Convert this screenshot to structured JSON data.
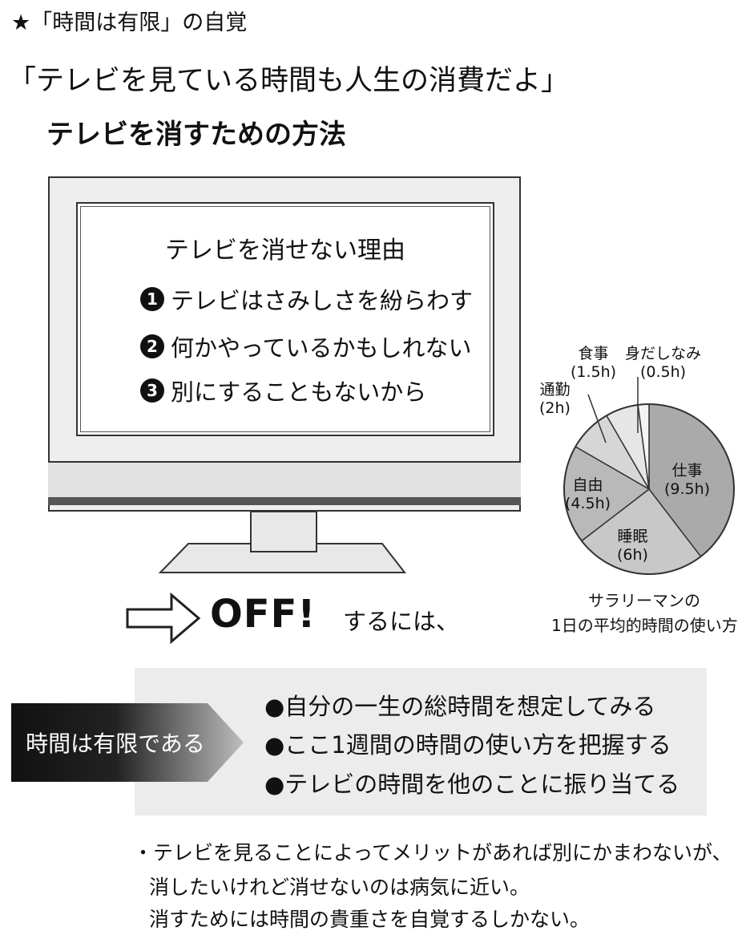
{
  "header": {
    "line1": "★「時間は有限」の自覚",
    "line2": "「テレビを見ている時間も人生の消費だよ」",
    "line3": "テレビを消すための方法"
  },
  "tv": {
    "title": "テレビを消せない理由",
    "reasons": [
      {
        "num": "1",
        "text": "テレビはさみしさを紛らわす"
      },
      {
        "num": "2",
        "text": "何かやっているかもしれない"
      },
      {
        "num": "3",
        "text": "別にすることもないから"
      }
    ]
  },
  "off": {
    "word": "OFF!",
    "suffix": "するには、"
  },
  "chart_data": {
    "type": "pie",
    "caption_line1": "サラリーマンの",
    "caption_line2": "1日の平均的時間の使い方",
    "slices": [
      {
        "label": "仕事",
        "value_label": "(9.5h)",
        "value": 9.5,
        "color": "#aaaaaa"
      },
      {
        "label": "睡眠",
        "value_label": "(6h)",
        "value": 6,
        "color": "#c8c8c8"
      },
      {
        "label": "自由",
        "value_label": "(4.5h)",
        "value": 4.5,
        "color": "#b9b9b9"
      },
      {
        "label": "通勤",
        "value_label": "(2h)",
        "value": 2,
        "color": "#d6d6d6"
      },
      {
        "label": "食事",
        "value_label": "(1.5h)",
        "value": 1.5,
        "color": "#e6e6e6"
      },
      {
        "label": "身だしなみ",
        "value_label": "(0.5h)",
        "value": 0.5,
        "color": "#f4f4f4"
      }
    ]
  },
  "panel": {
    "label": "時間は有限である",
    "bullets": [
      "●自分の一生の総時間を想定してみる",
      "●ここ1週間の時間の使い方を把握する",
      "●テレビの時間を他のことに振り当てる"
    ]
  },
  "note": {
    "line1": "・テレビを見ることによってメリットがあれば別にかまわないが、",
    "line2": "消したいけれど消せないのは病気に近い。",
    "line3": "消すためには時間の貴重さを自覚するしかない。"
  }
}
